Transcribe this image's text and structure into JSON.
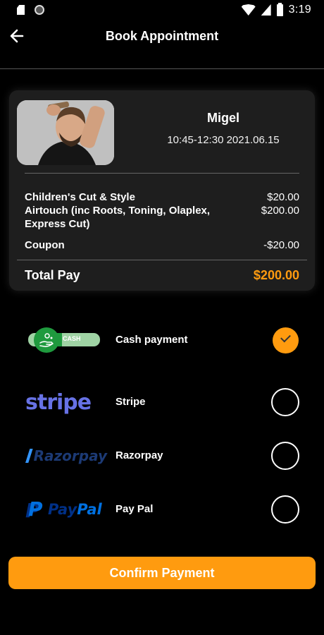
{
  "status_bar": {
    "time": "3:19",
    "icons": [
      "sd-card-icon",
      "circle-dot-icon",
      "wifi-icon",
      "signal-icon",
      "battery-icon"
    ]
  },
  "header": {
    "title": "Book Appointment",
    "back_icon": "arrow-left-icon"
  },
  "appointment": {
    "barber_name": "Migel",
    "time": "10:45-12:30 2021.06.15",
    "services": [
      {
        "name": "Children's Cut & Style",
        "price": "$20.00"
      },
      {
        "name": "Airtouch (inc Roots, Toning, Olaplex, Express Cut)",
        "price": "$200.00"
      }
    ],
    "coupon_label": "Coupon",
    "coupon_value": "-$20.00",
    "total_label": "Total Pay",
    "total_value": "$200.00"
  },
  "payment_methods": [
    {
      "label": "Cash payment",
      "logo": "cash-logo",
      "logo_text": "CASH",
      "selected": true
    },
    {
      "label": "Stripe",
      "logo": "stripe-logo",
      "logo_text": "stripe",
      "selected": false
    },
    {
      "label": "Razorpay",
      "logo": "razorpay-logo",
      "logo_text": "Razorpay",
      "selected": false
    },
    {
      "label": "Pay Pal",
      "logo": "paypal-logo",
      "logo_text_pay": "Pay",
      "logo_text_pal": "Pal",
      "selected": false
    }
  ],
  "confirm_button": {
    "label": "Confirm Payment"
  },
  "colors": {
    "accent": "#ff9b0f",
    "background": "#000000",
    "card": "#1e1e1e"
  }
}
